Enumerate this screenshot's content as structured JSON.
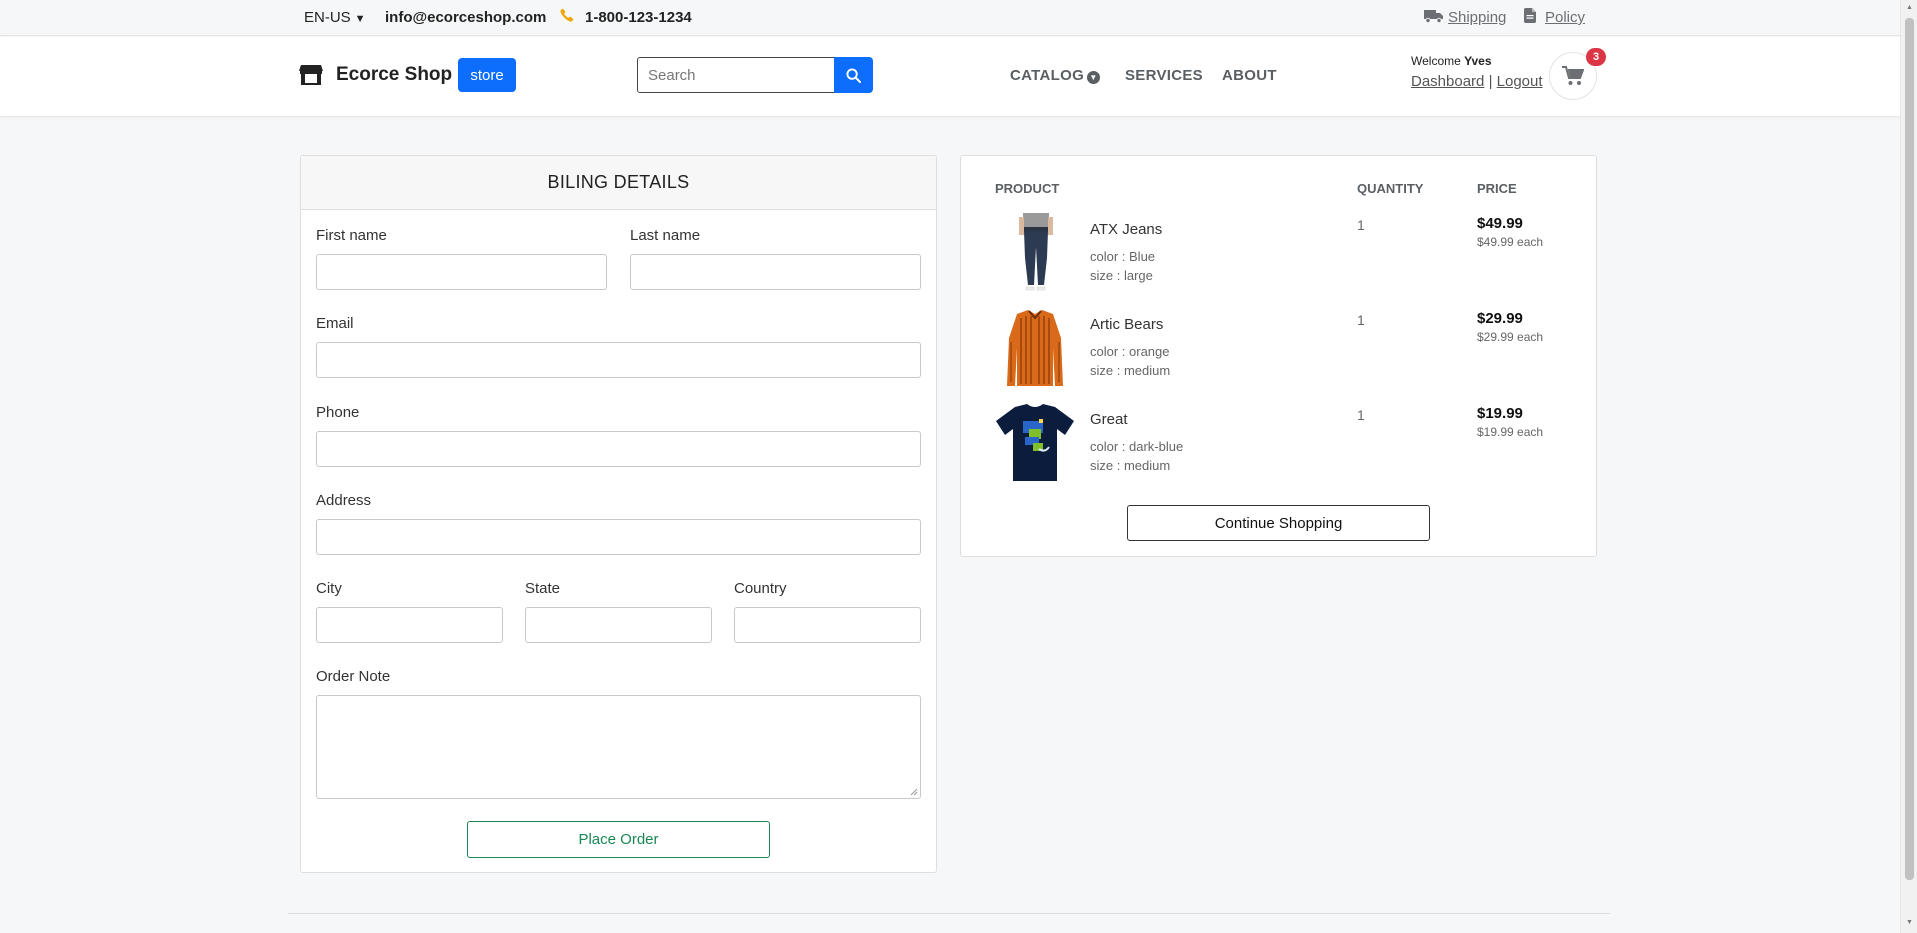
{
  "topbar": {
    "language": "EN-US",
    "email": "info@ecorceshop.com",
    "phone": "1-800-123-1234",
    "shipping_label": "Shipping",
    "policy_label": "Policy"
  },
  "header": {
    "brand": "Ecorce Shop",
    "store_label": "store",
    "search_placeholder": "Search",
    "nav": {
      "catalog": "CATALOG",
      "services": "SERVICES",
      "about": "ABOUT"
    },
    "welcome_prefix": "Welcome",
    "user_name": "Yves",
    "dashboard_label": "Dashboard",
    "separator": "|",
    "logout_label": "Logout",
    "cart_count": "3"
  },
  "billing": {
    "title": "BILING DETAILS",
    "first_name_label": "First name",
    "last_name_label": "Last name",
    "email_label": "Email",
    "phone_label": "Phone",
    "address_label": "Address",
    "city_label": "City",
    "state_label": "State",
    "country_label": "Country",
    "note_label": "Order Note",
    "place_order_label": "Place Order"
  },
  "order": {
    "headers": {
      "product": "PRODUCT",
      "quantity": "QUANTITY",
      "price": "PRICE"
    },
    "items": [
      {
        "name": "ATX Jeans",
        "color": "color : Blue",
        "size": "size : large",
        "quantity": "1",
        "price": "$49.99",
        "each": "$49.99 each",
        "image": "jeans-image"
      },
      {
        "name": "Artic Bears",
        "color": "color : orange",
        "size": "size : medium",
        "quantity": "1",
        "price": "$29.99",
        "each": "$29.99 each",
        "image": "orange-shirt-image"
      },
      {
        "name": "Great",
        "color": "color : dark-blue",
        "size": "size : medium",
        "quantity": "1",
        "price": "$19.99",
        "each": "$19.99 each",
        "image": "dark-blue-tshirt-image"
      }
    ],
    "continue_label": "Continue Shopping"
  },
  "colors": {
    "primary": "#0d6efd",
    "success": "#198754",
    "badge": "#dc3545",
    "phone_icon": "#f0a500"
  }
}
